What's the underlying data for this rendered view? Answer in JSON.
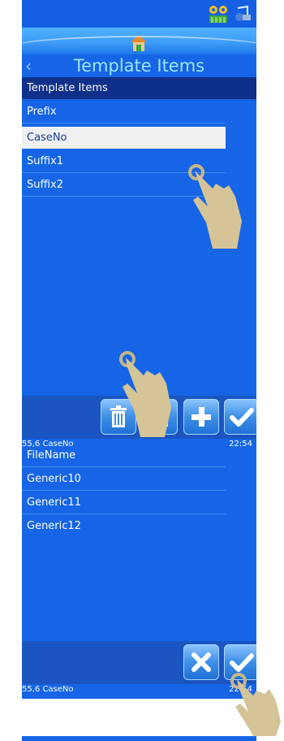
{
  "screen1": {
    "title": "Template Items",
    "list_header": "Template Items",
    "items": [
      "Prefix",
      "CaseNo",
      "Suffix1",
      "Suffix2"
    ],
    "selected_index": 1,
    "buttons": [
      "delete",
      "edit",
      "add",
      "confirm"
    ],
    "status_left": "55,6 CaseNo",
    "status_right": "22:54"
  },
  "screen2": {
    "items": [
      "FileName",
      "Generic10",
      "Generic11",
      "Generic12"
    ],
    "buttons": [
      "cancel",
      "confirm"
    ],
    "status_left": "55,6 CaseNo",
    "status_right": "22:54"
  },
  "icons": {
    "status_icons": [
      "printer-status-icon",
      "audio-status-icon"
    ],
    "home": "home-icon",
    "back": "back-arrow-icon"
  },
  "colors": {
    "panel_bg": "#1565e6",
    "header_row": "#0e2f8a",
    "title_text": "#9be7ff",
    "selected_row": "#eef0f2"
  }
}
